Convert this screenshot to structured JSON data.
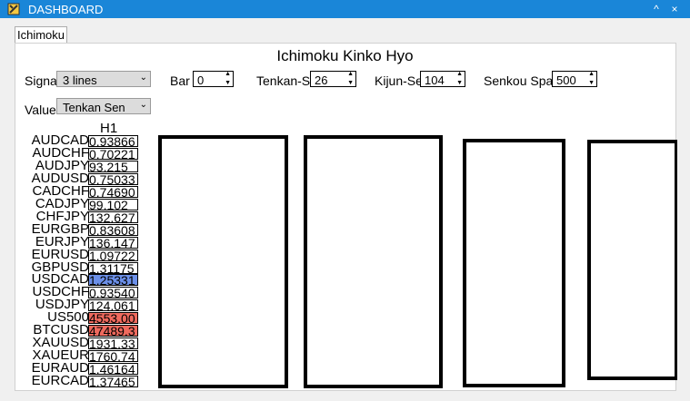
{
  "window": {
    "title": "DASHBOARD",
    "minimize_glyph": "^",
    "close_glyph": "×",
    "app_icon": "app-icon"
  },
  "tabs": [
    {
      "label": "Ichimoku"
    }
  ],
  "heading": "Ichimoku Kinko Hyo",
  "controls": {
    "signal": {
      "label": "Signa",
      "value": "3 lines"
    },
    "bar": {
      "label": "Bar",
      "value": "0"
    },
    "tenkan": {
      "label": "Tenkan-S",
      "value": "26"
    },
    "kijun": {
      "label": "Kijun-Se",
      "value": "104"
    },
    "senkou": {
      "label": "Senkou Spa",
      "value": "500"
    },
    "value": {
      "label": "Value",
      "value": "Tenkan Sen"
    }
  },
  "table": {
    "column_header": "H1",
    "rows": [
      {
        "symbol": "AUDCAD",
        "value": "0.93866",
        "color": "#ffffff"
      },
      {
        "symbol": "AUDCHF",
        "value": "0.70221",
        "color": "#ffffff"
      },
      {
        "symbol": "AUDJPY",
        "value": "93.215",
        "color": "#ffffff"
      },
      {
        "symbol": "AUDUSD",
        "value": "0.75033",
        "color": "#ffffff"
      },
      {
        "symbol": "CADCHF",
        "value": "0.74690",
        "color": "#ffffff"
      },
      {
        "symbol": "CADJPY",
        "value": "99.102",
        "color": "#ffffff"
      },
      {
        "symbol": "CHFJPY",
        "value": "132.627",
        "color": "#ffffff"
      },
      {
        "symbol": "EURGBP",
        "value": "0.83608",
        "color": "#ffffff"
      },
      {
        "symbol": "EURJPY",
        "value": "136.147",
        "color": "#ffffff"
      },
      {
        "symbol": "EURUSD",
        "value": "1.09722",
        "color": "#ffffff"
      },
      {
        "symbol": "GBPUSD",
        "value": "1.31175",
        "color": "#ffffff"
      },
      {
        "symbol": "USDCAD",
        "value": "1.25331",
        "color": "#6b8fe8"
      },
      {
        "symbol": "USDCHF",
        "value": "0.93540",
        "color": "#ffffff"
      },
      {
        "symbol": "USDJPY",
        "value": "124.061",
        "color": "#ffffff"
      },
      {
        "symbol": "US500",
        "value": "4553.00",
        "color": "#ef6a5e"
      },
      {
        "symbol": "BTCUSD",
        "value": "47489.3",
        "color": "#ef6a5e"
      },
      {
        "symbol": "XAUUSD",
        "value": "1931.33",
        "color": "#ffffff"
      },
      {
        "symbol": "XAUEUR",
        "value": "1760.74",
        "color": "#ffffff"
      },
      {
        "symbol": "EURAUD",
        "value": "1.46164",
        "color": "#ffffff"
      },
      {
        "symbol": "EURCAD",
        "value": "1.37465",
        "color": "#ffffff"
      }
    ]
  }
}
